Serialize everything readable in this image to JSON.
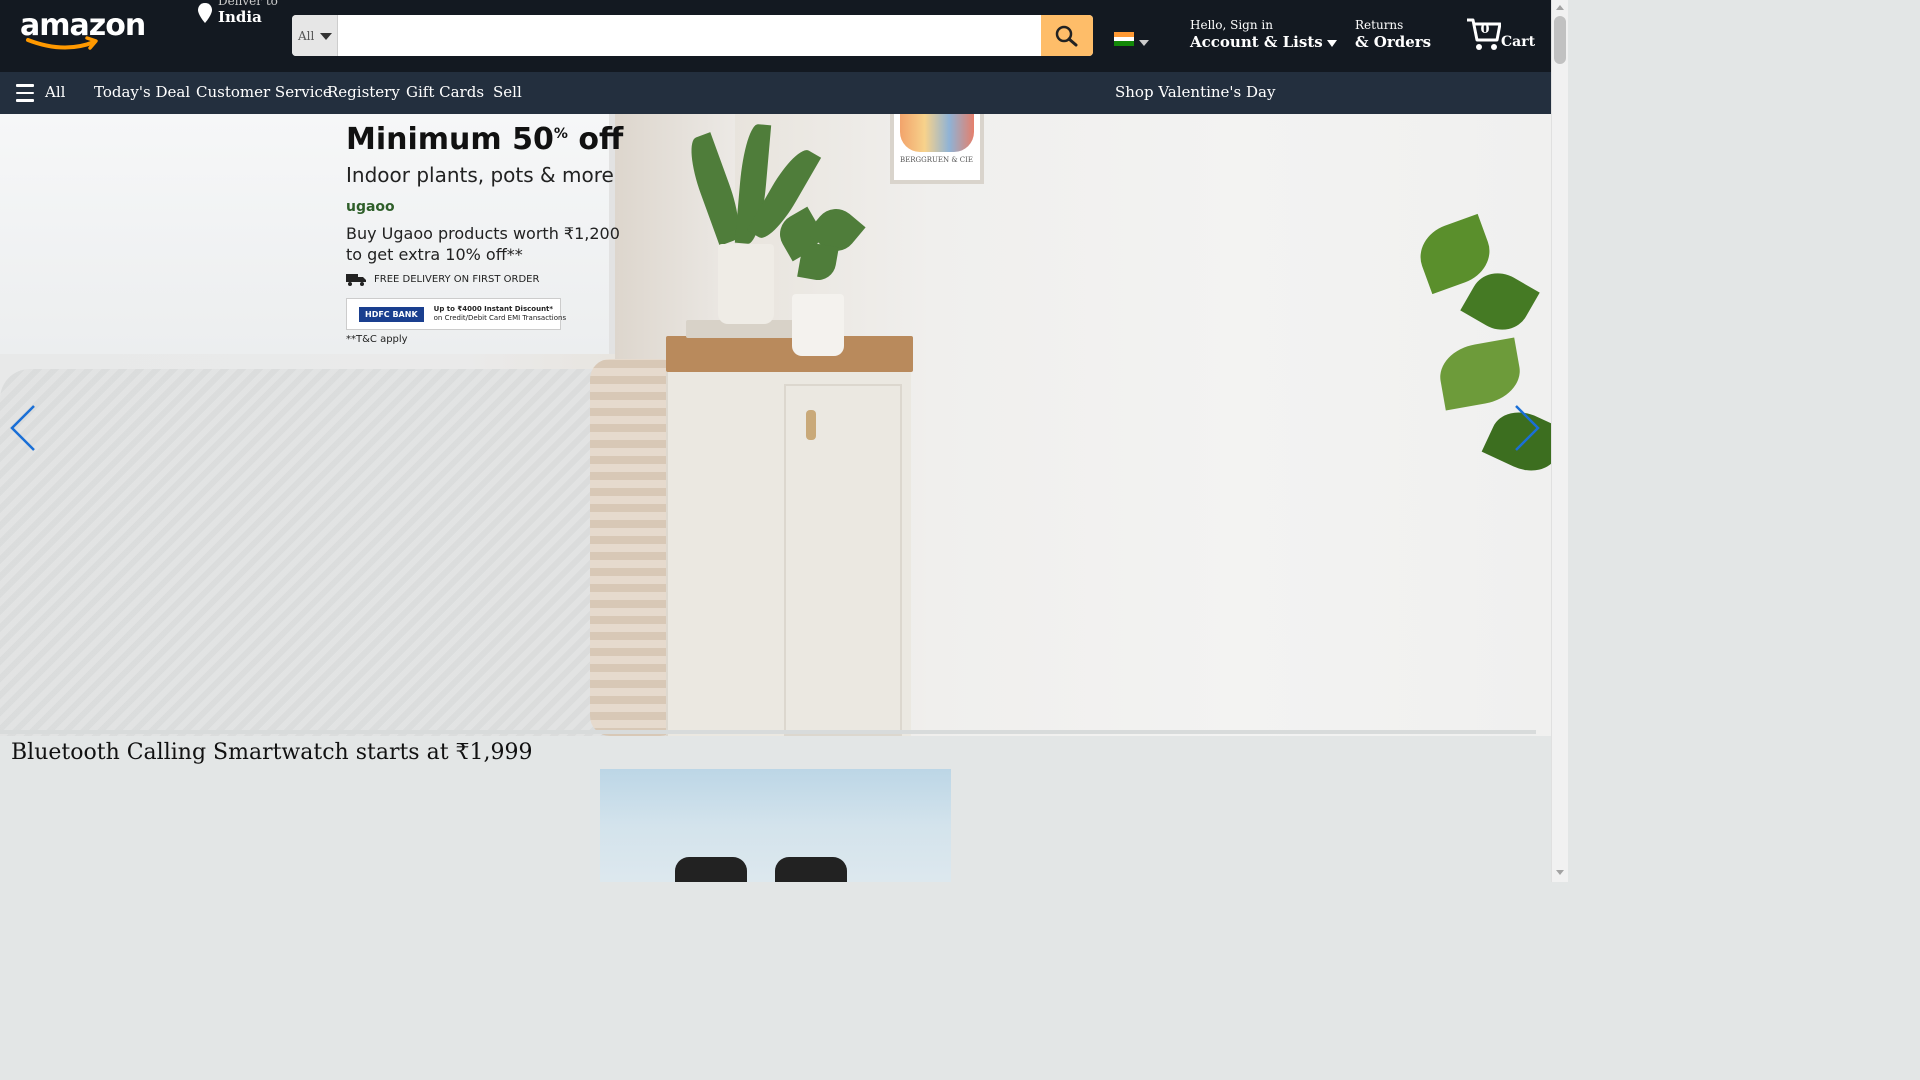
{
  "header": {
    "logo_text": "amazon",
    "deliver_label": "Deliver to",
    "deliver_location": "India",
    "search": {
      "category": "All",
      "value": "",
      "placeholder": ""
    },
    "account": {
      "greeting": "Hello, Sign in",
      "label": "Account & Lists"
    },
    "orders": {
      "line1": "Returns",
      "line2": "& Orders"
    },
    "cart": {
      "count": "0",
      "label": "Cart"
    }
  },
  "subnav": {
    "all_label": "All",
    "items": [
      "Today's Deal",
      "Customer Service",
      "Registery",
      "Gift Cards",
      "Sell"
    ],
    "promo": "Shop Valentine's Day"
  },
  "hero": {
    "headline": "Minimum 50",
    "headline_sup": "%",
    "headline_suffix": " off",
    "subheadline": "Indoor plants, pots & more",
    "brand": "ugaoo",
    "offer_line1": "Buy Ugaoo products worth ₹1,200",
    "offer_line2": "to get extra 10% off**",
    "free_delivery": "FREE DELIVERY ON FIRST ORDER",
    "bank_name": "HDFC BANK",
    "bank_offer_line1": "Up to ₹4000 Instant Discount*",
    "bank_offer_line2": "on Credit/Debit Card EMI Transactions",
    "tnc": "**T&C apply",
    "frame_caption": "BERGGRUEN & CIE"
  },
  "section": {
    "title": "Bluetooth Calling Smartwatch starts at ₹1,999"
  },
  "colors": {
    "header_bg": "#131921",
    "subnav_bg": "#232f3e",
    "search_button": "#febd69",
    "accent": "#ff9900",
    "carousel_arrow": "#1a6fd6",
    "page_bg": "#e3e6e6"
  },
  "icons": {
    "location": "location-pin-icon",
    "search": "search-icon",
    "flag": "india-flag-icon",
    "cart": "cart-icon",
    "menu": "hamburger-icon",
    "prev": "chevron-left-icon",
    "next": "chevron-right-icon"
  }
}
